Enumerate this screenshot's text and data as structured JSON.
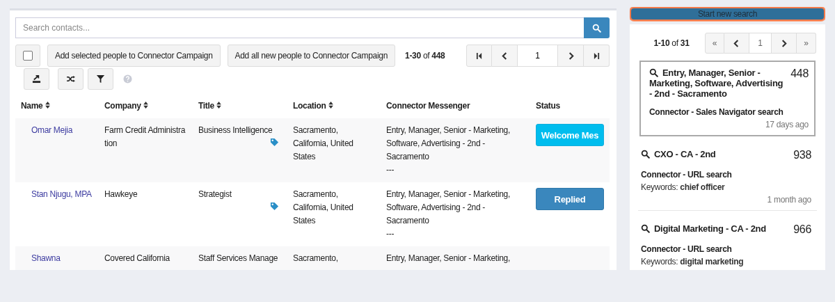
{
  "search": {
    "placeholder": "Search contacts..."
  },
  "toolbar": {
    "select_all_checked": false,
    "buttons": [
      "Add selected people to Connector Campaign",
      "Add all new people to Connector Campaign"
    ],
    "count": "**1-30** of **448**",
    "page": "1"
  },
  "columns": [
    {
      "label": "Name",
      "sortable": true
    },
    {
      "label": "Company",
      "sortable": true
    },
    {
      "label": "Title",
      "sortable": true
    },
    {
      "label": "Location",
      "sortable": true
    },
    {
      "label": "Connector Messenger",
      "sortable": false
    },
    {
      "label": "Status",
      "sortable": false
    }
  ],
  "rows": [
    {
      "name": "Omar Mejia",
      "company": "Farm Credit Administration",
      "title": "Business Intelligence",
      "tagged": true,
      "location": "Sacramento, California, United States",
      "messenger": "Entry, Manager, Senior - Marketing, Software, Advertising - 2nd - Sacramento",
      "note": "---",
      "status": {
        "kind": "welcome",
        "label": "Welcome Mes"
      }
    },
    {
      "name": "Stan Njugu, MPA",
      "company": "Hawkeye",
      "title": "Strategist",
      "tagged": true,
      "location": "Sacramento, California, United States",
      "messenger": "Entry, Manager, Senior - Marketing, Software, Advertising - 2nd - Sacramento",
      "note": "---",
      "status": {
        "kind": "replied",
        "label": "Replied"
      }
    },
    {
      "name": "Shawna",
      "company": "Covered California",
      "title": "Staff Services Manage",
      "tagged": false,
      "location": "Sacramento,",
      "messenger": "Entry, Manager, Senior - Marketing,"
    }
  ],
  "sidebar": {
    "new_search_button": "Start new search",
    "count": "**1-10** of **31**",
    "first": "«",
    "page": "1",
    "last": "»",
    "searches": [
      {
        "title": "Entry, Manager, Senior - Marketing, Software, Advertising - 2nd - Sacramento",
        "count": "448",
        "type": "Connector - Sales Navigator search",
        "time": "17 days ago",
        "selected": true
      },
      {
        "title": "CXO - CA - 2nd",
        "count": "938",
        "type": "Connector - URL search",
        "keywords_label": "Keywords:",
        "keywords": "chief officer",
        "time": "1 month ago",
        "selected": false
      },
      {
        "title": "Digital Marketing - CA - 2nd",
        "count": "966",
        "type": "Connector - URL search",
        "keywords_label": "Keywords:",
        "keywords": "digital marketing",
        "selected": false
      }
    ]
  }
}
